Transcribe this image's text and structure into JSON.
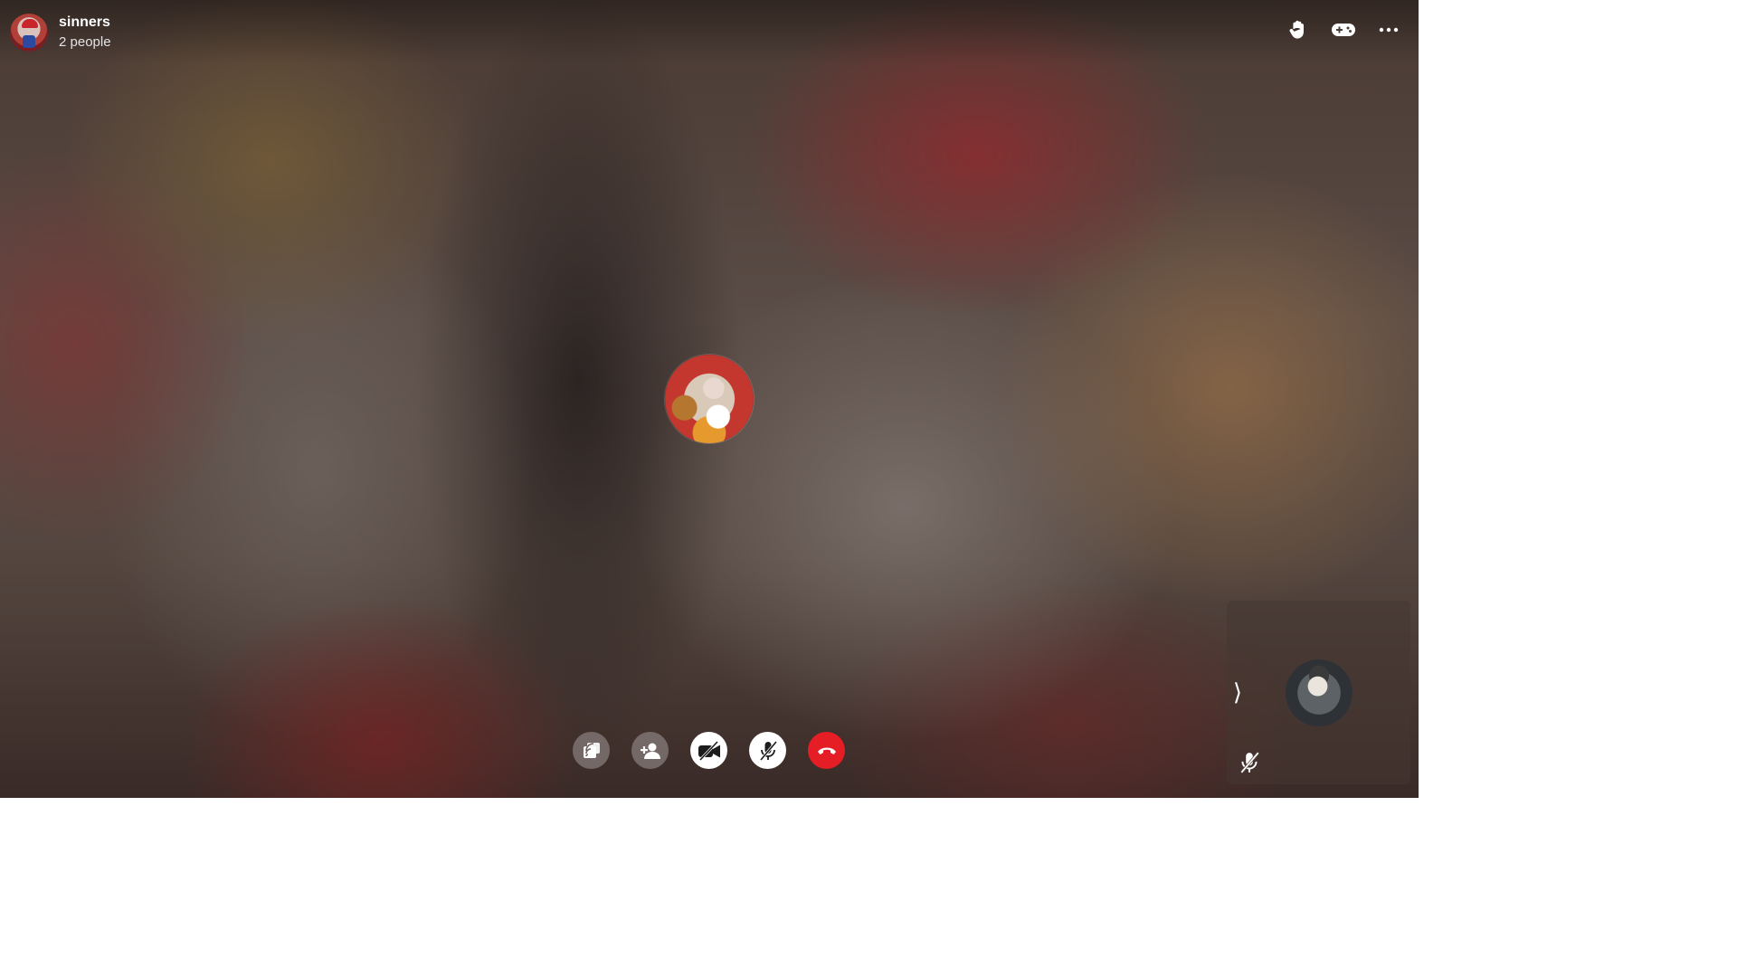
{
  "call": {
    "group_name": "sinners",
    "participant_count": "2 people"
  },
  "top_actions": [
    {
      "name": "raise-hand",
      "icon": "hand-wave-icon"
    },
    {
      "name": "games",
      "icon": "gamepad-icon"
    },
    {
      "name": "more-options",
      "icon": "more-horizontal-icon"
    }
  ],
  "controls": [
    {
      "name": "share-screen",
      "icon": "cast-icon",
      "style": "dark"
    },
    {
      "name": "add-person",
      "icon": "add-person-icon",
      "style": "dark"
    },
    {
      "name": "camera-off",
      "icon": "video-off-icon",
      "style": "light"
    },
    {
      "name": "mic-off",
      "icon": "mic-off-icon",
      "style": "light"
    },
    {
      "name": "end-call",
      "icon": "phone-hangup-icon",
      "style": "end"
    }
  ],
  "self_view": {
    "collapse_glyph": "⟩",
    "muted": true
  },
  "colors": {
    "end_call": "#e41e24",
    "control_light": "#ffffff",
    "text": "#ffffff"
  }
}
